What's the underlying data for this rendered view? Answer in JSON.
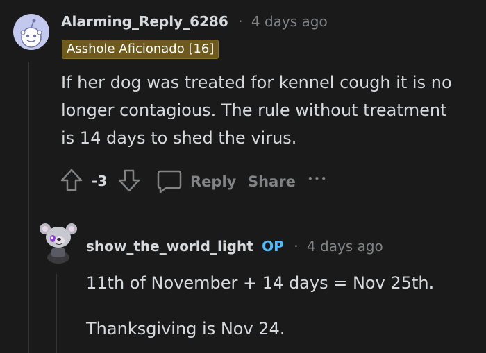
{
  "comments": [
    {
      "username": "Alarming_Reply_6286",
      "separator": "·",
      "timestamp": "4 days ago",
      "flair": "Asshole Aficionado [16]",
      "body_lines": [
        "If her dog was treated for kennel cough it is no",
        "longer contagious. The rule without treatment",
        "is 14 days to shed the virus."
      ],
      "actions": {
        "score": "-3",
        "reply": "Reply",
        "share": "Share",
        "more": "•••"
      },
      "icons": [
        "reddit-snoo-avatar",
        "upvote-icon",
        "downvote-icon",
        "comment-bubble-icon",
        "more-options-icon"
      ]
    },
    {
      "username": "show_the_world_light",
      "op_badge": "OP",
      "separator": "·",
      "timestamp": "4 days ago",
      "body_lines": [
        "11th of November + 14 days = Nov 25th.",
        "Thanksgiving is Nov 24."
      ],
      "icons": [
        "koala-avatar"
      ]
    }
  ],
  "colors": {
    "background": "#1a1a1b",
    "text": "#d7dadc",
    "meta": "#818384",
    "flair_bg": "#6e5a1c",
    "op": "#4fbcff",
    "avatar_bg": "#c3c8ee"
  }
}
